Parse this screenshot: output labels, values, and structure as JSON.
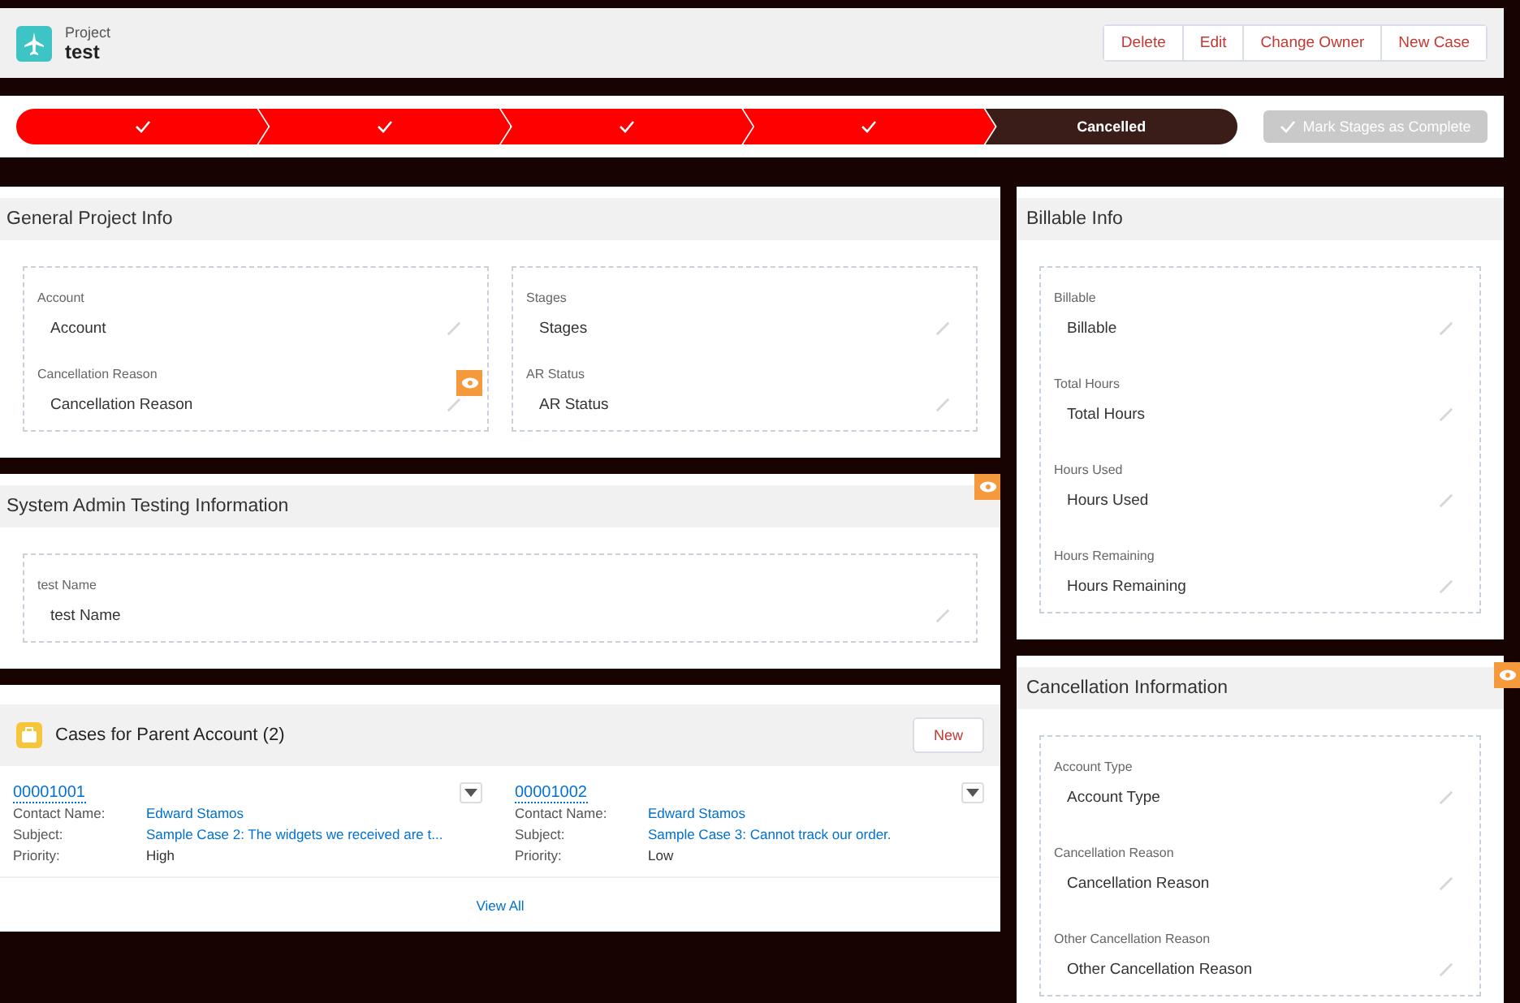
{
  "header": {
    "object_type": "Project",
    "title": "test",
    "actions": [
      "Delete",
      "Edit",
      "Change Owner",
      "New Case"
    ]
  },
  "path": {
    "stages": [
      {
        "complete": true
      },
      {
        "complete": true
      },
      {
        "complete": true
      },
      {
        "complete": true
      },
      {
        "label": "Cancelled",
        "complete": false
      }
    ],
    "mark_button": {
      "label": "Mark Stages as Complete",
      "disabled": true
    }
  },
  "left_sections": [
    {
      "title": "General Project Info",
      "columns": [
        [
          {
            "label": "Account",
            "value": "Account"
          },
          {
            "label": "Cancellation Reason",
            "value": "Cancellation Reason"
          }
        ],
        [
          {
            "label": "Stages",
            "value": "Stages"
          },
          {
            "label": "AR Status",
            "value": "AR Status"
          }
        ]
      ]
    },
    {
      "title": "System Admin Testing Information",
      "columns": [
        [
          {
            "label": "test Name",
            "value": "test Name"
          }
        ]
      ]
    }
  ],
  "cases": {
    "title": "Cases for Parent Account (2)",
    "new_button": "New",
    "items": [
      {
        "number": "00001001",
        "fields": [
          {
            "label": "Contact Name:",
            "value": "Edward Stamos",
            "link": true
          },
          {
            "label": "Subject:",
            "value": "Sample Case 2: The widgets we received are t...",
            "link": true
          },
          {
            "label": "Priority:",
            "value": "High",
            "link": false
          }
        ]
      },
      {
        "number": "00001002",
        "fields": [
          {
            "label": "Contact Name:",
            "value": "Edward Stamos",
            "link": true
          },
          {
            "label": "Subject:",
            "value": "Sample Case 3: Cannot track our order.",
            "link": true
          },
          {
            "label": "Priority:",
            "value": "Low",
            "link": false
          }
        ]
      }
    ],
    "view_all": "View All"
  },
  "right_sections": [
    {
      "title": "Billable Info",
      "columns": [
        [
          {
            "label": "Billable",
            "value": "Billable"
          },
          {
            "label": "Total Hours",
            "value": "Total Hours"
          },
          {
            "label": "Hours Used",
            "value": "Hours Used"
          },
          {
            "label": "Hours Remaining",
            "value": "Hours Remaining"
          }
        ]
      ]
    },
    {
      "title": "Cancellation Information",
      "columns": [
        [
          {
            "label": "Account Type",
            "value": "Account Type"
          },
          {
            "label": "Cancellation Reason",
            "value": "Cancellation Reason"
          },
          {
            "label": "Other Cancellation Reason",
            "value": "Other Cancellation Reason"
          }
        ]
      ]
    }
  ]
}
